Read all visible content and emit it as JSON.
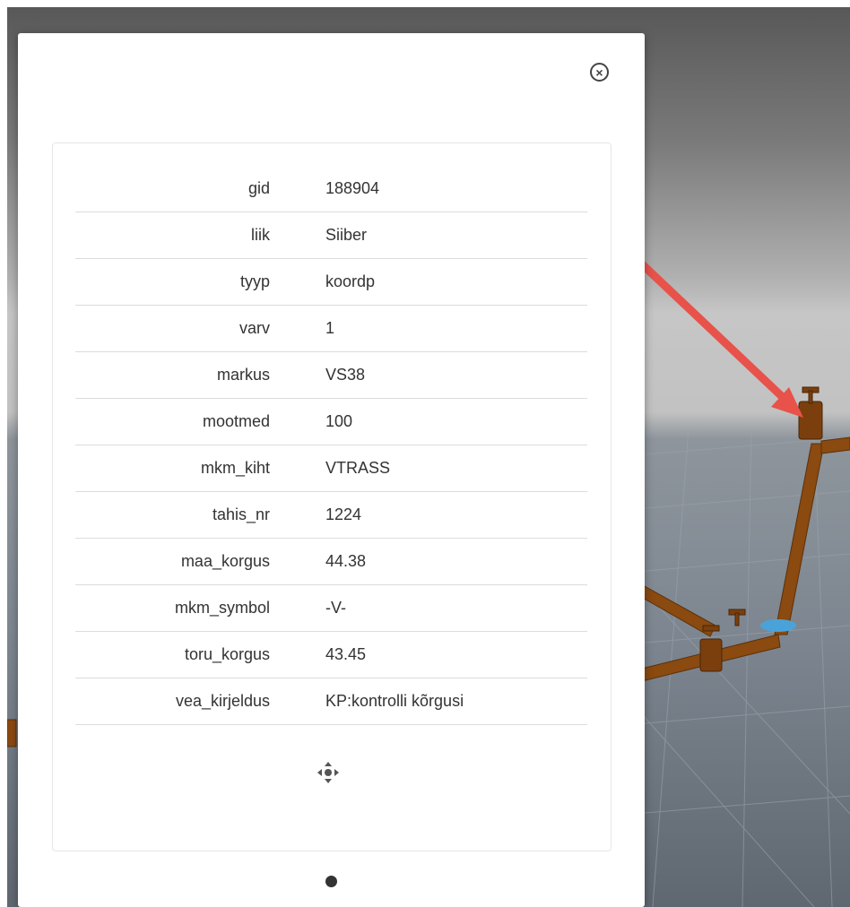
{
  "popup": {
    "close_label": "×",
    "attributes": [
      {
        "key": "gid",
        "value": "188904"
      },
      {
        "key": "liik",
        "value": "Siiber"
      },
      {
        "key": "tyyp",
        "value": "koordp"
      },
      {
        "key": "varv",
        "value": "1"
      },
      {
        "key": "markus",
        "value": "VS38"
      },
      {
        "key": "mootmed",
        "value": "100"
      },
      {
        "key": "mkm_kiht",
        "value": "VTRASS"
      },
      {
        "key": "tahis_nr",
        "value": "1224"
      },
      {
        "key": "maa_korgus",
        "value": "44.38"
      },
      {
        "key": "mkm_symbol",
        "value": "-V-"
      },
      {
        "key": "toru_korgus",
        "value": "43.45"
      },
      {
        "key": "vea_kirjeldus",
        "value": "KP:kontrolli kõrgusi"
      }
    ]
  },
  "colors": {
    "pipe": "#8a4a10",
    "arrow": "#e8524a",
    "valve_highlight": "#4aa3d8"
  }
}
